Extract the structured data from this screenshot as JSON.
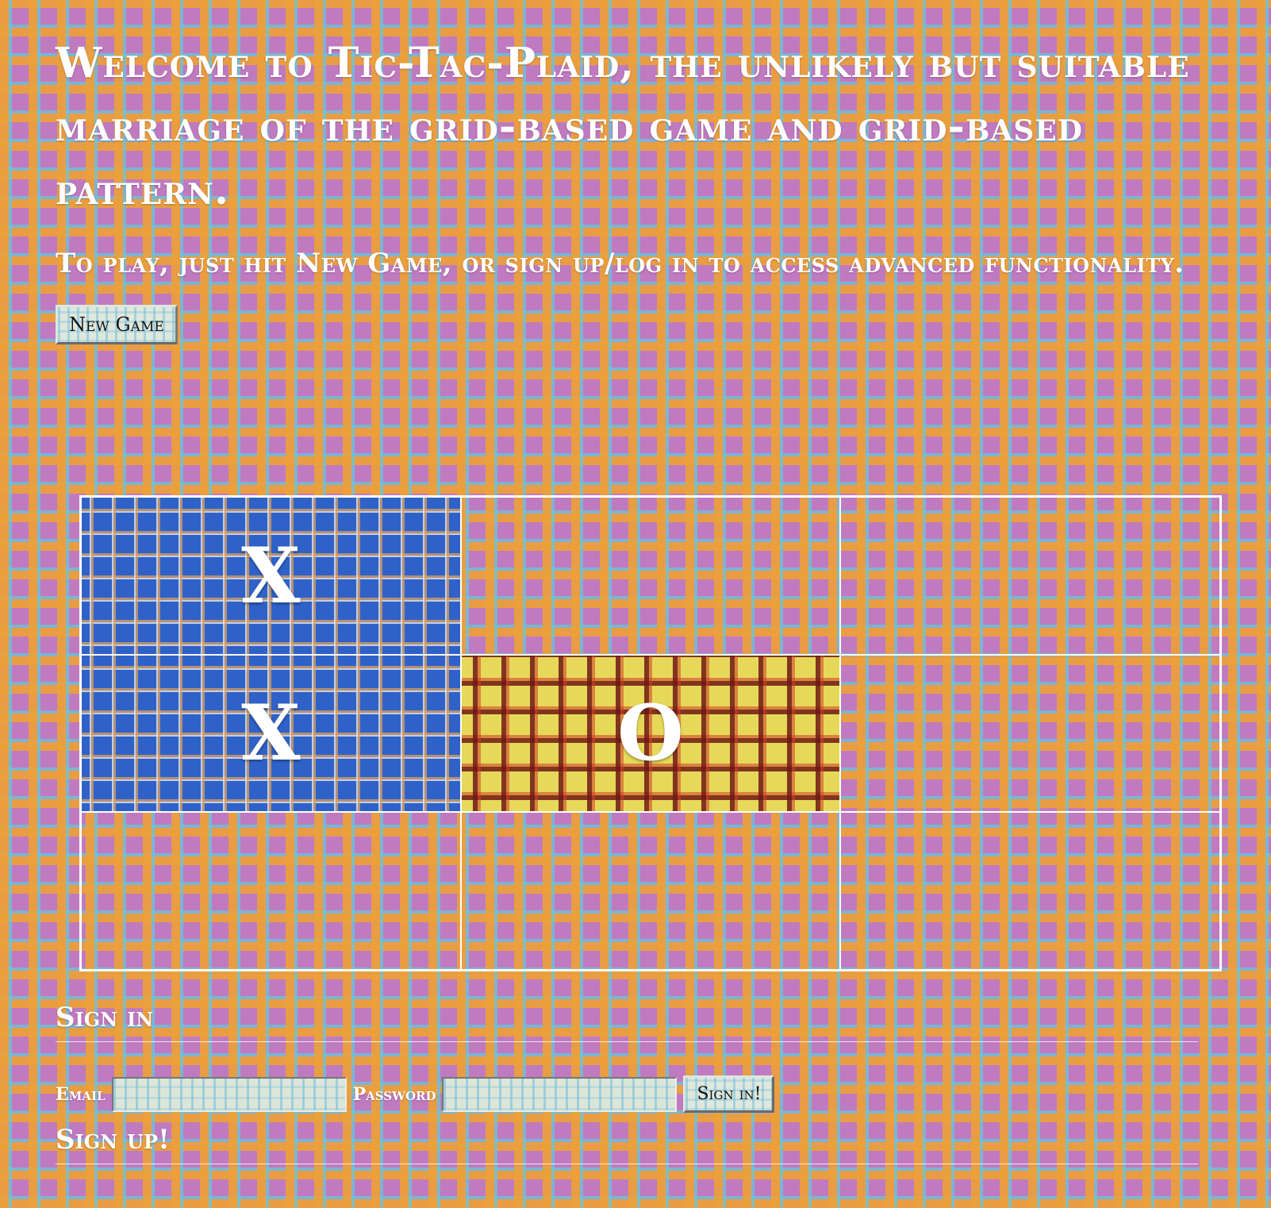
{
  "header": {
    "welcome": "Welcome to Tic-Tac-Plaid, the unlikely but suitable marriage of the grid-based game and grid-based pattern.",
    "instructions": "To play, just hit New Game, or sign up/log in to access advanced functionality."
  },
  "controls": {
    "new_game_label": "New Game"
  },
  "board": {
    "cells": [
      "X",
      "",
      "",
      "X",
      "O",
      "",
      "",
      "",
      ""
    ],
    "x_plaid_color": "#2f62c8",
    "o_plaid_color": "#e6d95a"
  },
  "signin": {
    "title": "Sign in",
    "email_label": "Email",
    "email_value": "",
    "password_label": "Password",
    "password_value": "",
    "submit_label": "Sign in!"
  },
  "signup": {
    "title": "Sign up!"
  },
  "colors": {
    "page_base": "#c07ac0",
    "plaid_orange": "#eca03a",
    "plaid_blue": "#6ec3d7"
  }
}
